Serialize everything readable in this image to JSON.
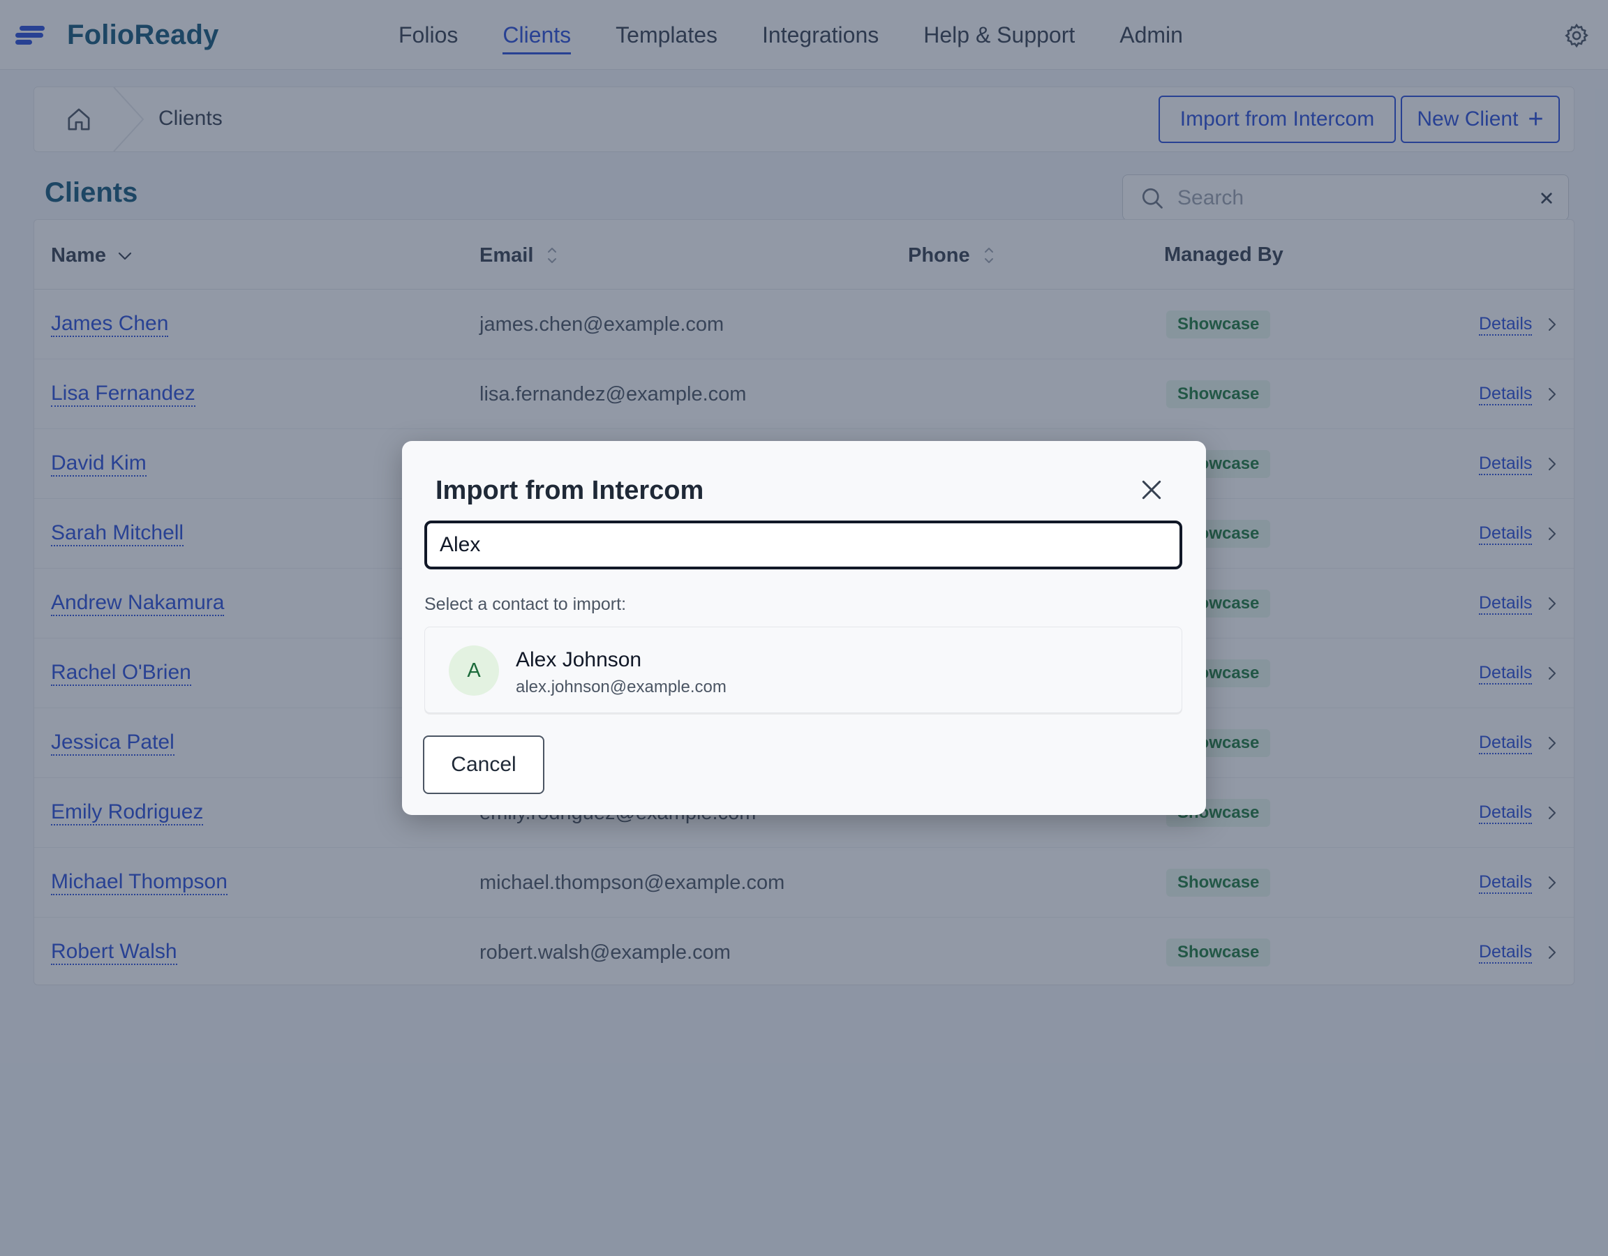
{
  "app": {
    "name": "FolioReady"
  },
  "nav": {
    "links": [
      "Folios",
      "Clients",
      "Templates",
      "Integrations",
      "Help & Support",
      "Admin"
    ],
    "active": "Clients"
  },
  "breadcrumb": {
    "current": "Clients"
  },
  "actions": {
    "import_label": "Import from Intercom",
    "new_label": "New Client",
    "new_icon": "plus-icon"
  },
  "page": {
    "title": "Clients"
  },
  "search": {
    "placeholder": "Search",
    "value": ""
  },
  "table": {
    "columns": {
      "name": "Name",
      "email": "Email",
      "phone": "Phone",
      "managed_by": "Managed By"
    },
    "details_label": "Details",
    "rows": [
      {
        "name": "James Chen",
        "email": "james.chen@example.com",
        "managed_by": "Showcase"
      },
      {
        "name": "Lisa Fernandez",
        "email": "lisa.fernandez@example.com",
        "managed_by": "Showcase"
      },
      {
        "name": "David Kim",
        "email": "",
        "managed_by": "Showcase"
      },
      {
        "name": "Sarah Mitchell",
        "email": "",
        "managed_by": "Showcase"
      },
      {
        "name": "Andrew Nakamura",
        "email": "",
        "managed_by": "Showcase"
      },
      {
        "name": "Rachel O'Brien",
        "email": "",
        "managed_by": "Showcase"
      },
      {
        "name": "Jessica Patel",
        "email": "",
        "managed_by": "Showcase"
      },
      {
        "name": "Emily Rodriguez",
        "email": "emily.rodriguez@example.com",
        "managed_by": "Showcase"
      },
      {
        "name": "Michael Thompson",
        "email": "michael.thompson@example.com",
        "managed_by": "Showcase"
      },
      {
        "name": "Robert Walsh",
        "email": "robert.walsh@example.com",
        "managed_by": "Showcase"
      }
    ]
  },
  "modal": {
    "title": "Import from Intercom",
    "input_value": "Alex",
    "hint": "Select a contact to import:",
    "contact": {
      "initial": "A",
      "name": "Alex Johnson",
      "email": "alex.johnson@example.com"
    },
    "cancel_label": "Cancel"
  },
  "colors": {
    "accent": "#2b4fd8",
    "brand_text": "#15597a",
    "badge_bg": "#e8f6ec",
    "badge_text": "#1f7a3f"
  }
}
